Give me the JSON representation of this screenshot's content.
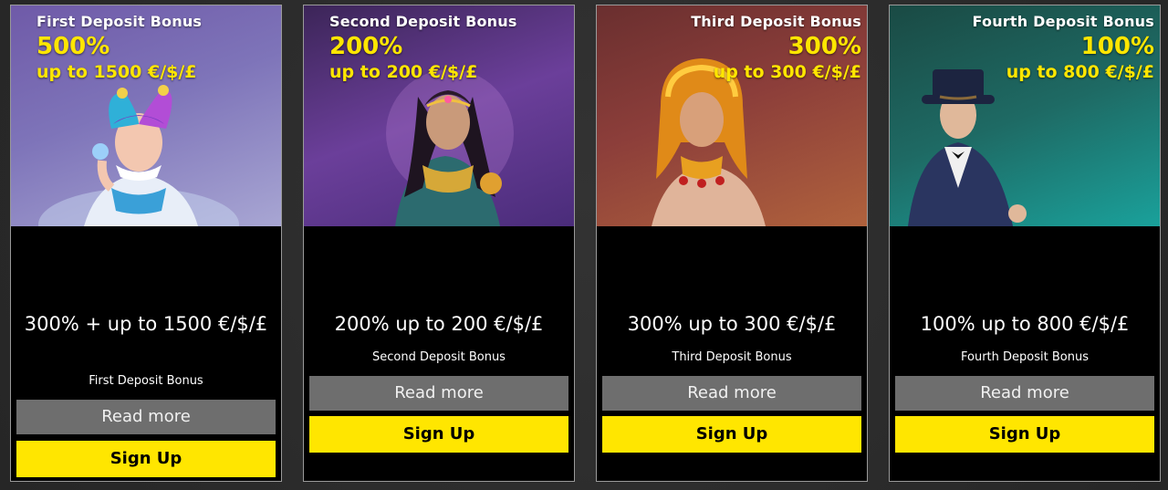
{
  "cards": [
    {
      "hero_title": "First Deposit Bonus",
      "hero_percent": "500%",
      "hero_upto": "up to 1500 €/$/£",
      "character_icon": "jester-character-icon",
      "offer": "300% + up to 1500 €/$/£",
      "subtitle": "First Deposit Bonus",
      "read_more": "Read more",
      "sign_up": "Sign Up"
    },
    {
      "hero_title": "Second Deposit Bonus",
      "hero_percent": "200%",
      "hero_upto": "up to 200 €/$/£",
      "character_icon": "fortune-teller-character-icon",
      "offer": "200% up to 200 €/$/£",
      "subtitle": "Second Deposit Bonus",
      "read_more": "Read more",
      "sign_up": "Sign Up"
    },
    {
      "hero_title": "Third Deposit Bonus",
      "hero_percent": "300%",
      "hero_upto": "up to 300 €/$/£",
      "character_icon": "cleopatra-character-icon",
      "offer": "300% up to 300 €/$/£",
      "subtitle": "Third Deposit Bonus",
      "read_more": "Read more",
      "sign_up": "Sign Up"
    },
    {
      "hero_title": "Fourth Deposit Bonus",
      "hero_percent": "100%",
      "hero_upto": "up to 800 €/$/£",
      "character_icon": "gentleman-top-hat-character-icon",
      "offer": "100% up to 800 €/$/£",
      "subtitle": "Fourth Deposit Bonus",
      "read_more": "Read more",
      "sign_up": "Sign Up"
    }
  ],
  "colors": {
    "accent_yellow": "#ffe600",
    "read_more_gray": "#6e6e6e",
    "card_background": "#000000",
    "page_background": "#2a2a2a"
  }
}
